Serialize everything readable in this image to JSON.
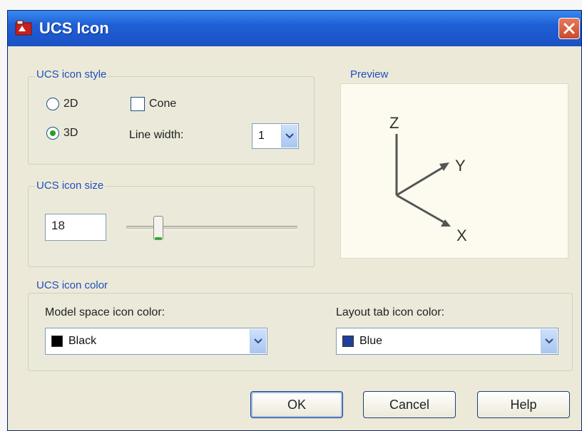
{
  "window": {
    "title": "UCS Icon",
    "close_icon": "close-icon"
  },
  "style_group": {
    "title": "UCS icon style",
    "radio_2d_label": "2D",
    "radio_3d_label": "3D",
    "selected_style": "3D",
    "cone_label": "Cone",
    "cone_checked": false,
    "line_width_label": "Line width:",
    "line_width_value": "1"
  },
  "preview_group": {
    "title": "Preview",
    "axis_z": "Z",
    "axis_y": "Y",
    "axis_x": "X"
  },
  "size_group": {
    "title": "UCS icon size",
    "size_value": "18",
    "slider_fraction": 0.25
  },
  "color_group": {
    "title": "UCS icon color",
    "model_label": "Model space icon color:",
    "model_value": "Black",
    "model_swatch": "#000000",
    "layout_label": "Layout tab icon color:",
    "layout_value": "Blue",
    "layout_swatch": "#1f3f9a"
  },
  "buttons": {
    "ok": "OK",
    "cancel": "Cancel",
    "help": "Help"
  }
}
